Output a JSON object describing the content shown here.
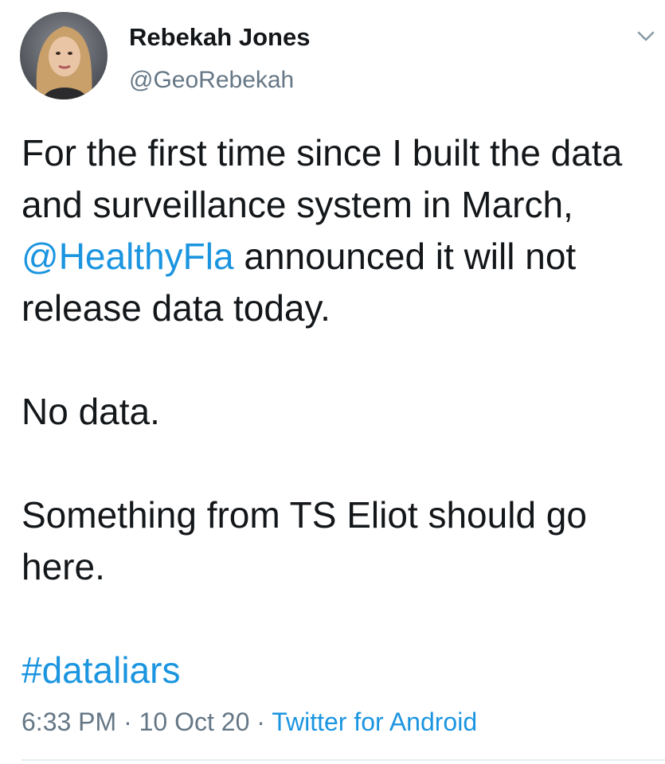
{
  "user": {
    "display_name": "Rebekah Jones",
    "handle": "@GeoRebekah"
  },
  "tweet": {
    "line1_pre": "For the first time since I built the data and surveillance system in March, ",
    "mention": "@HealthyFla",
    "line1_post": " announced it will not release data today.",
    "para2": "No data.",
    "para3": "Something from TS Eliot should go here.",
    "hashtag": "#dataliars"
  },
  "meta": {
    "time": "6:33 PM",
    "sep1": " · ",
    "date": "10 Oct 20",
    "sep2": " · ",
    "source": "Twitter for Android"
  },
  "icons": {
    "menu": "chevron-down-icon",
    "avatar": "avatar"
  },
  "colors": {
    "link": "#1b95e0",
    "text": "#14171a",
    "muted": "#657786",
    "divider": "#e6ecf0"
  }
}
